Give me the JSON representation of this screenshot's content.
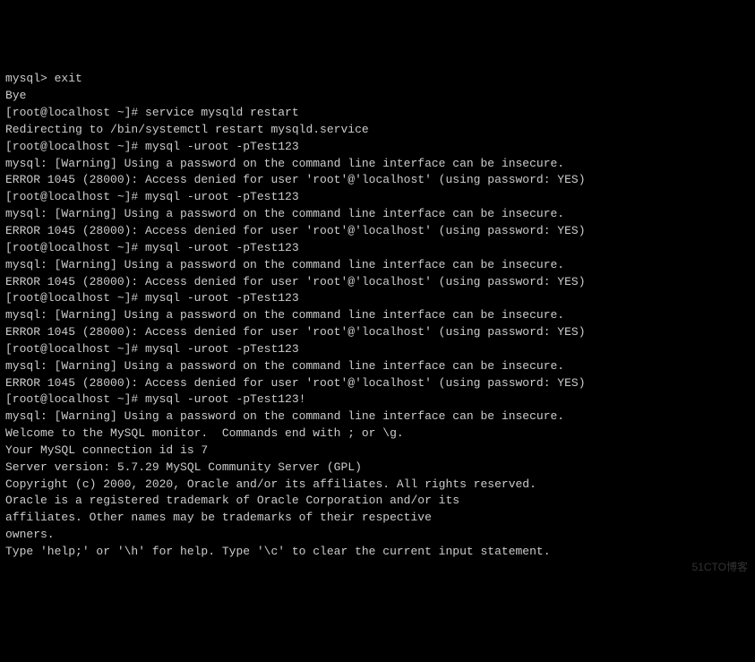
{
  "lines": [
    "mysql> exit",
    "Bye",
    "[root@localhost ~]# service mysqld restart",
    "Redirecting to /bin/systemctl restart mysqld.service",
    "[root@localhost ~]# mysql -uroot -pTest123",
    "mysql: [Warning] Using a password on the command line interface can be insecure.",
    "ERROR 1045 (28000): Access denied for user 'root'@'localhost' (using password: YES)",
    "[root@localhost ~]# mysql -uroot -pTest123",
    "mysql: [Warning] Using a password on the command line interface can be insecure.",
    "ERROR 1045 (28000): Access denied for user 'root'@'localhost' (using password: YES)",
    "[root@localhost ~]# mysql -uroot -pTest123",
    "mysql: [Warning] Using a password on the command line interface can be insecure.",
    "ERROR 1045 (28000): Access denied for user 'root'@'localhost' (using password: YES)",
    "[root@localhost ~]# mysql -uroot -pTest123",
    "mysql: [Warning] Using a password on the command line interface can be insecure.",
    "ERROR 1045 (28000): Access denied for user 'root'@'localhost' (using password: YES)",
    "[root@localhost ~]# mysql -uroot -pTest123",
    "mysql: [Warning] Using a password on the command line interface can be insecure.",
    "ERROR 1045 (28000): Access denied for user 'root'@'localhost' (using password: YES)",
    "[root@localhost ~]# mysql -uroot -pTest123!",
    "mysql: [Warning] Using a password on the command line interface can be insecure.",
    "Welcome to the MySQL monitor.  Commands end with ; or \\g.",
    "Your MySQL connection id is 7",
    "Server version: 5.7.29 MySQL Community Server (GPL)",
    "",
    "Copyright (c) 2000, 2020, Oracle and/or its affiliates. All rights reserved.",
    "",
    "Oracle is a registered trademark of Oracle Corporation and/or its",
    "affiliates. Other names may be trademarks of their respective",
    "owners.",
    "",
    "Type 'help;' or '\\h' for help. Type '\\c' to clear the current input statement."
  ],
  "watermark": "51CTO博客"
}
